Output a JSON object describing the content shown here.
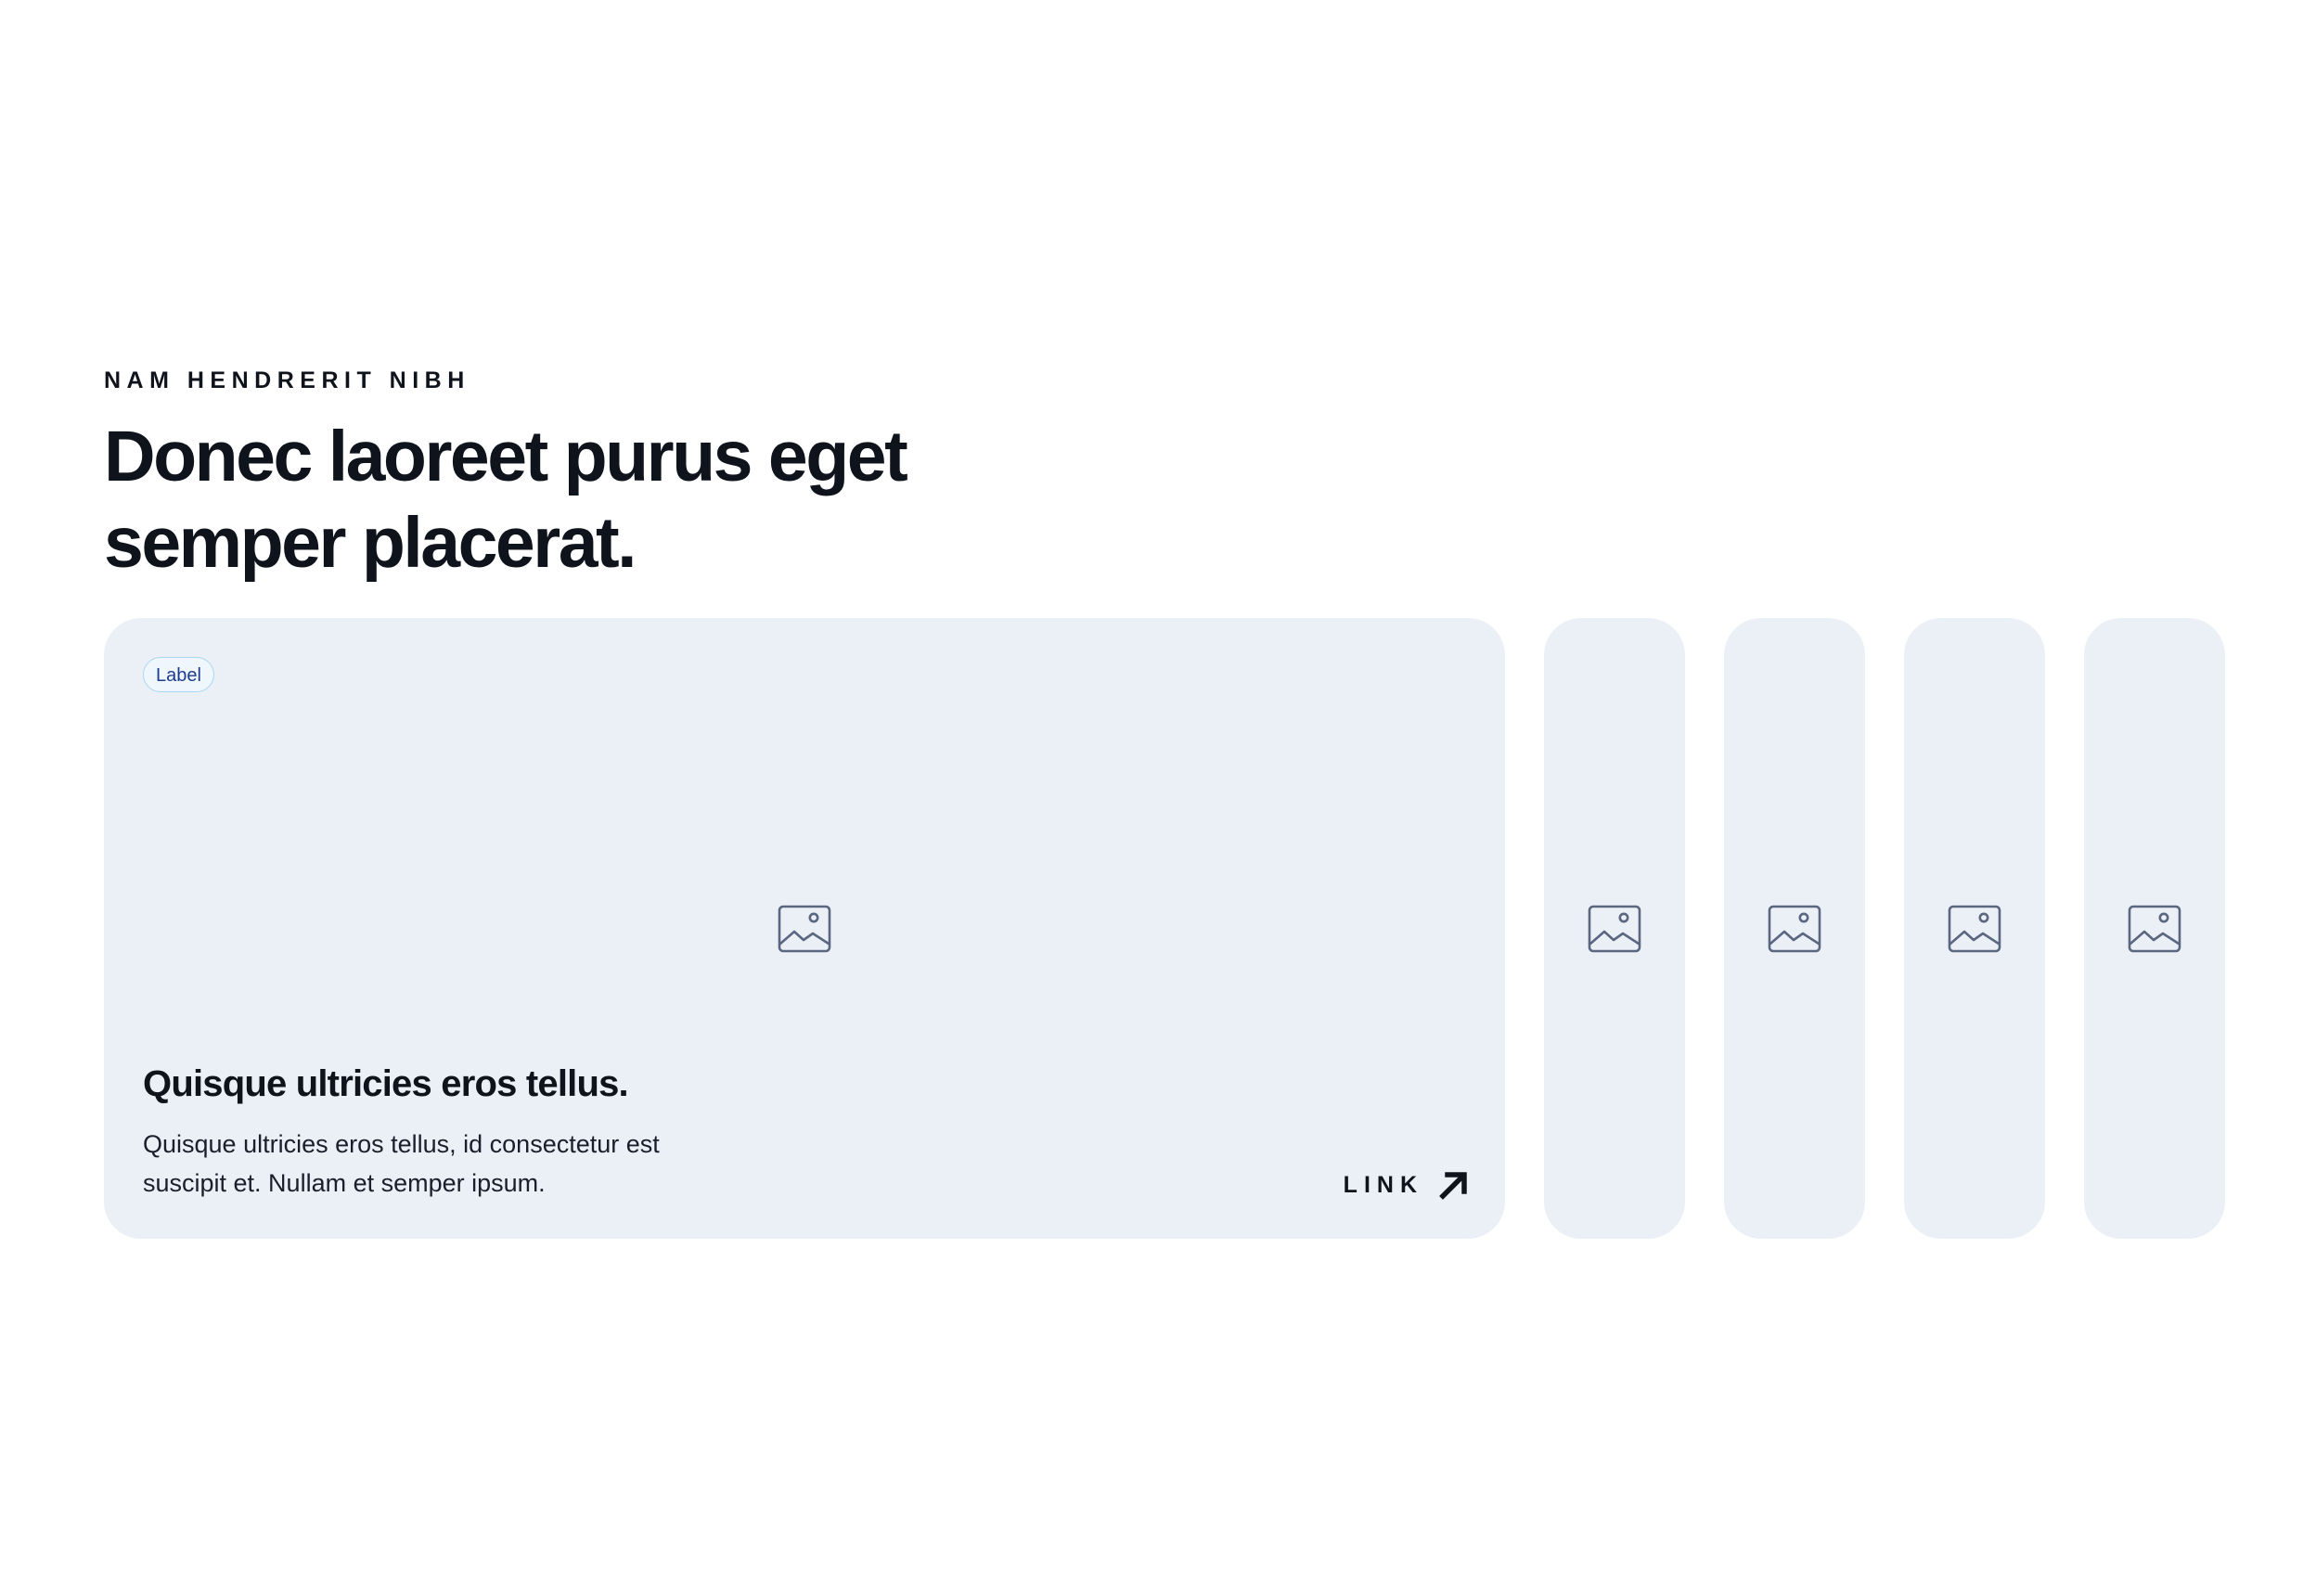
{
  "header": {
    "eyebrow": "NAM HENDRERIT NIBH",
    "headline": "Donec laoreet purus eget semper placerat."
  },
  "carousel": {
    "active_card": {
      "label": "Label",
      "image_icon": "image-placeholder-icon",
      "title": "Quisque ultricies eros tellus.",
      "body": "Quisque ultricies eros tellus, id consectetur est suscipit et. Nullam et semper ipsum.",
      "link_label": "LINK",
      "link_icon": "arrow-up-right-icon"
    },
    "collapsed_cards": [
      {
        "image_icon": "image-placeholder-icon"
      },
      {
        "image_icon": "image-placeholder-icon"
      },
      {
        "image_icon": "image-placeholder-icon"
      },
      {
        "image_icon": "image-placeholder-icon"
      }
    ]
  },
  "colors": {
    "text": "#0f141c",
    "card_background": "#ebf0f7",
    "icon_stroke": "#5b6680",
    "chip_border": "#a9d6f2",
    "chip_text": "#1d3c8f"
  }
}
